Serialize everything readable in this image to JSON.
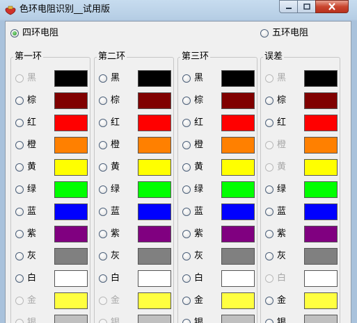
{
  "window": {
    "title": "色环电阻识别__试用版"
  },
  "mode": {
    "four_band_label": "四环电阻",
    "five_band_label": "五环电阻",
    "selected": "four"
  },
  "colors": {
    "black": "#000000",
    "brown": "#800000",
    "red": "#ff0000",
    "orange": "#ff8000",
    "yellow": "#ffff00",
    "green": "#00ff00",
    "blue": "#0000ff",
    "purple": "#800080",
    "gray": "#808080",
    "white": "#ffffff",
    "gold": "#ffff40",
    "silver": "#c0c0c0"
  },
  "groups": [
    {
      "title": "第一环",
      "rows": [
        {
          "label": "黑",
          "color": "#000000",
          "enabled": false
        },
        {
          "label": "棕",
          "color": "#800000",
          "enabled": true
        },
        {
          "label": "红",
          "color": "#ff0000",
          "enabled": true
        },
        {
          "label": "橙",
          "color": "#ff8000",
          "enabled": true
        },
        {
          "label": "黄",
          "color": "#ffff00",
          "enabled": true
        },
        {
          "label": "绿",
          "color": "#00ff00",
          "enabled": true
        },
        {
          "label": "蓝",
          "color": "#0000ff",
          "enabled": true
        },
        {
          "label": "紫",
          "color": "#800080",
          "enabled": true
        },
        {
          "label": "灰",
          "color": "#808080",
          "enabled": true
        },
        {
          "label": "白",
          "color": "#ffffff",
          "enabled": true
        },
        {
          "label": "金",
          "color": "#ffff40",
          "enabled": false
        },
        {
          "label": "银",
          "color": "#c0c0c0",
          "enabled": false
        }
      ]
    },
    {
      "title": "第二环",
      "rows": [
        {
          "label": "黑",
          "color": "#000000",
          "enabled": true
        },
        {
          "label": "棕",
          "color": "#800000",
          "enabled": true
        },
        {
          "label": "红",
          "color": "#ff0000",
          "enabled": true
        },
        {
          "label": "橙",
          "color": "#ff8000",
          "enabled": true
        },
        {
          "label": "黄",
          "color": "#ffff00",
          "enabled": true
        },
        {
          "label": "绿",
          "color": "#00ff00",
          "enabled": true
        },
        {
          "label": "蓝",
          "color": "#0000ff",
          "enabled": true
        },
        {
          "label": "紫",
          "color": "#800080",
          "enabled": true
        },
        {
          "label": "灰",
          "color": "#808080",
          "enabled": true
        },
        {
          "label": "白",
          "color": "#ffffff",
          "enabled": true
        },
        {
          "label": "金",
          "color": "#ffff40",
          "enabled": false
        },
        {
          "label": "银",
          "color": "#c0c0c0",
          "enabled": false
        }
      ]
    },
    {
      "title": "第三环",
      "rows": [
        {
          "label": "黑",
          "color": "#000000",
          "enabled": true
        },
        {
          "label": "棕",
          "color": "#800000",
          "enabled": true
        },
        {
          "label": "红",
          "color": "#ff0000",
          "enabled": true
        },
        {
          "label": "橙",
          "color": "#ff8000",
          "enabled": true
        },
        {
          "label": "黄",
          "color": "#ffff00",
          "enabled": true
        },
        {
          "label": "绿",
          "color": "#00ff00",
          "enabled": true
        },
        {
          "label": "蓝",
          "color": "#0000ff",
          "enabled": true
        },
        {
          "label": "紫",
          "color": "#800080",
          "enabled": true
        },
        {
          "label": "灰",
          "color": "#808080",
          "enabled": true
        },
        {
          "label": "白",
          "color": "#ffffff",
          "enabled": true
        },
        {
          "label": "金",
          "color": "#ffff40",
          "enabled": true
        },
        {
          "label": "银",
          "color": "#c0c0c0",
          "enabled": true
        }
      ]
    },
    {
      "title": "误差",
      "rows": [
        {
          "label": "黑",
          "color": "#000000",
          "enabled": false
        },
        {
          "label": "棕",
          "color": "#800000",
          "enabled": true
        },
        {
          "label": "红",
          "color": "#ff0000",
          "enabled": true
        },
        {
          "label": "橙",
          "color": "#ff8000",
          "enabled": false
        },
        {
          "label": "黄",
          "color": "#ffff00",
          "enabled": false
        },
        {
          "label": "绿",
          "color": "#00ff00",
          "enabled": true
        },
        {
          "label": "蓝",
          "color": "#0000ff",
          "enabled": true
        },
        {
          "label": "紫",
          "color": "#800080",
          "enabled": true
        },
        {
          "label": "灰",
          "color": "#808080",
          "enabled": true
        },
        {
          "label": "白",
          "color": "#ffffff",
          "enabled": false
        },
        {
          "label": "金",
          "color": "#ffff40",
          "enabled": true
        },
        {
          "label": "银",
          "color": "#c0c0c0",
          "enabled": true
        }
      ]
    }
  ]
}
